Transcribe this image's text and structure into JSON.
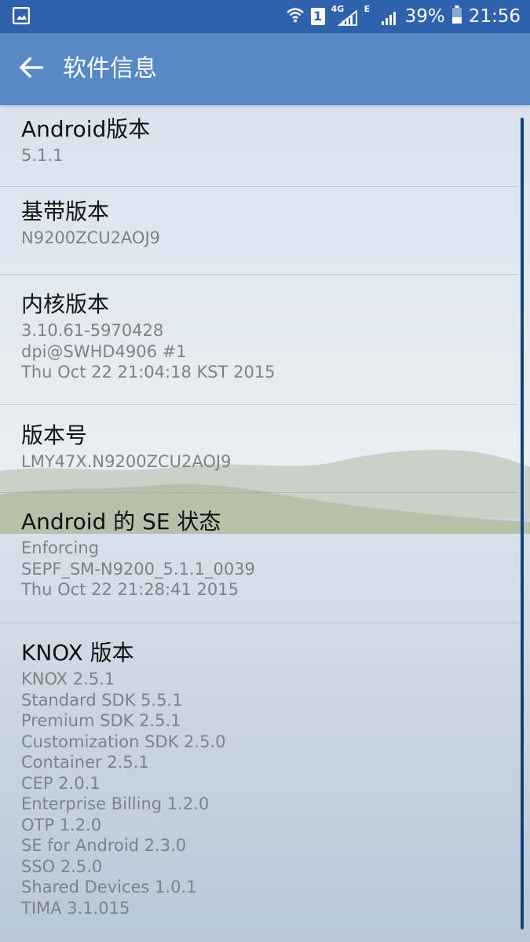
{
  "status_bar": {
    "battery": "39%",
    "time": "21:56",
    "sim_slot": "1",
    "network_4g": "4G",
    "network_e": "E"
  },
  "app_bar": {
    "title": "软件信息"
  },
  "items": [
    {
      "title": "Android版本",
      "lines": [
        "5.1.1"
      ]
    },
    {
      "title": "基带版本",
      "lines": [
        "N9200ZCU2AOJ9"
      ]
    },
    {
      "title": "内核版本",
      "lines": [
        "3.10.61-5970428",
        "dpi@SWHD4906 #1",
        "Thu Oct 22 21:04:18 KST 2015"
      ]
    },
    {
      "title": "版本号",
      "lines": [
        "LMY47X.N9200ZCU2AOJ9"
      ]
    },
    {
      "title": "Android 的 SE 状态",
      "lines": [
        "Enforcing",
        "SEPF_SM-N9200_5.1.1_0039",
        "Thu Oct 22 21:28:41 2015"
      ]
    },
    {
      "title": "KNOX 版本",
      "lines": [
        "KNOX 2.5.1",
        "Standard SDK 5.5.1",
        "Premium SDK 2.5.1",
        "Customization SDK 2.5.0",
        "Container 2.5.1",
        "CEP 2.0.1",
        "Enterprise Billing 1.2.0",
        "OTP 1.2.0",
        "SE for Android 2.3.0",
        "SSO 2.5.0",
        "Shared Devices 1.0.1",
        "TIMA 3.1.015"
      ]
    }
  ]
}
